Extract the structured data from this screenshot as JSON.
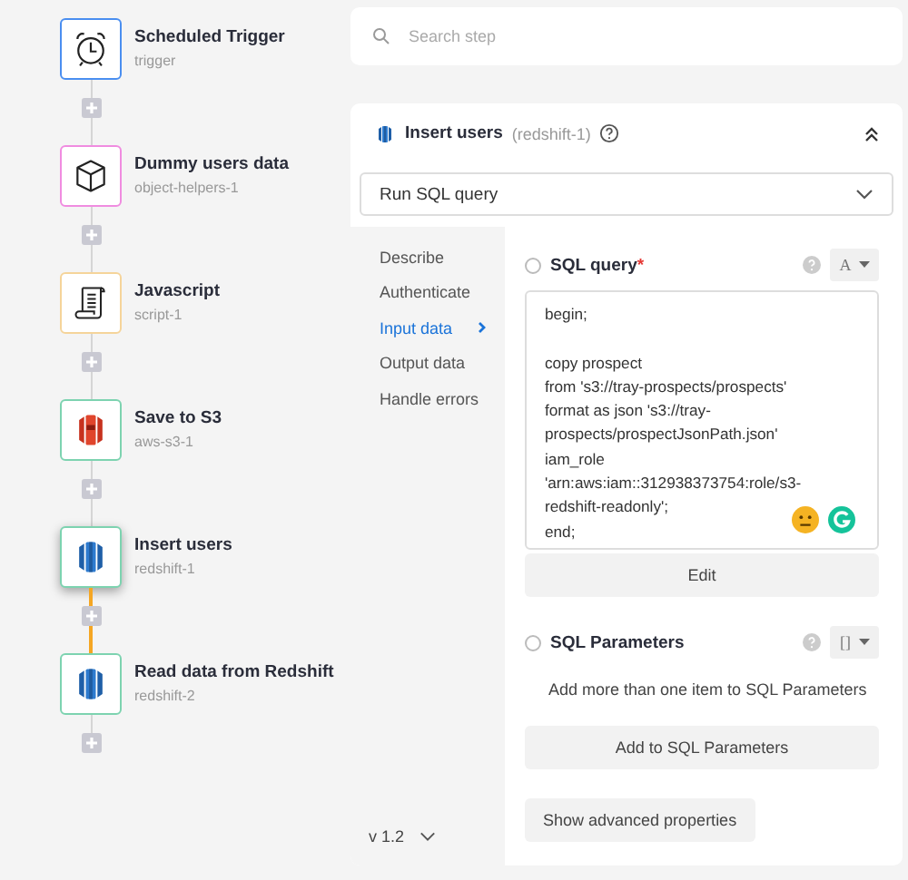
{
  "workflow": {
    "steps": [
      {
        "kind": "clock",
        "title": "Scheduled Trigger",
        "id": "trigger",
        "color": "#4a8ef0",
        "selected": false
      },
      {
        "kind": "cube",
        "title": "Dummy users data",
        "id": "object-helpers-1",
        "color": "#f08ce0",
        "selected": false
      },
      {
        "kind": "script",
        "title": "Javascript",
        "id": "script-1",
        "color": "#f5d49a",
        "selected": false
      },
      {
        "kind": "s3",
        "title": "Save to S3",
        "id": "aws-s3-1",
        "color": "#7dd3b0",
        "selected": false
      },
      {
        "kind": "redshift",
        "title": "Insert users",
        "id": "redshift-1",
        "color": "#7dd3b0",
        "selected": true
      },
      {
        "kind": "redshift",
        "title": "Read data from Redshift",
        "id": "redshift-2",
        "color": "#7dd3b0",
        "selected": false
      }
    ]
  },
  "search": {
    "placeholder": "Search step"
  },
  "panel": {
    "title": "Insert users",
    "id": "(redshift-1)",
    "expanded": true,
    "operation": "Run SQL query",
    "nav": [
      {
        "label": "Describe",
        "selected": false
      },
      {
        "label": "Authenticate",
        "selected": false
      },
      {
        "label": "Input data",
        "selected": true
      },
      {
        "label": "Output data",
        "selected": false
      },
      {
        "label": "Handle errors",
        "selected": false
      }
    ],
    "version": "v 1.2",
    "fields": [
      {
        "kind": "text",
        "label": "SQL query",
        "required_mark": "*",
        "checked": false,
        "type_glyph": "A",
        "value": "begin;\n\ncopy prospect\nfrom 's3://tray-prospects/prospects'\nformat as json 's3://tray-prospects/prospectJsonPath.json'\niam_role\n'arn:aws:iam::312938373754:role/s3-redshift-readonly';\nend;",
        "button": "Edit"
      },
      {
        "kind": "list",
        "label": "SQL Parameters",
        "checked": false,
        "type_glyph": "[]",
        "hint": "Add more than one item to SQL Parameters",
        "button": "Add to SQL Parameters"
      }
    ],
    "advanced_button": "Show advanced properties"
  }
}
